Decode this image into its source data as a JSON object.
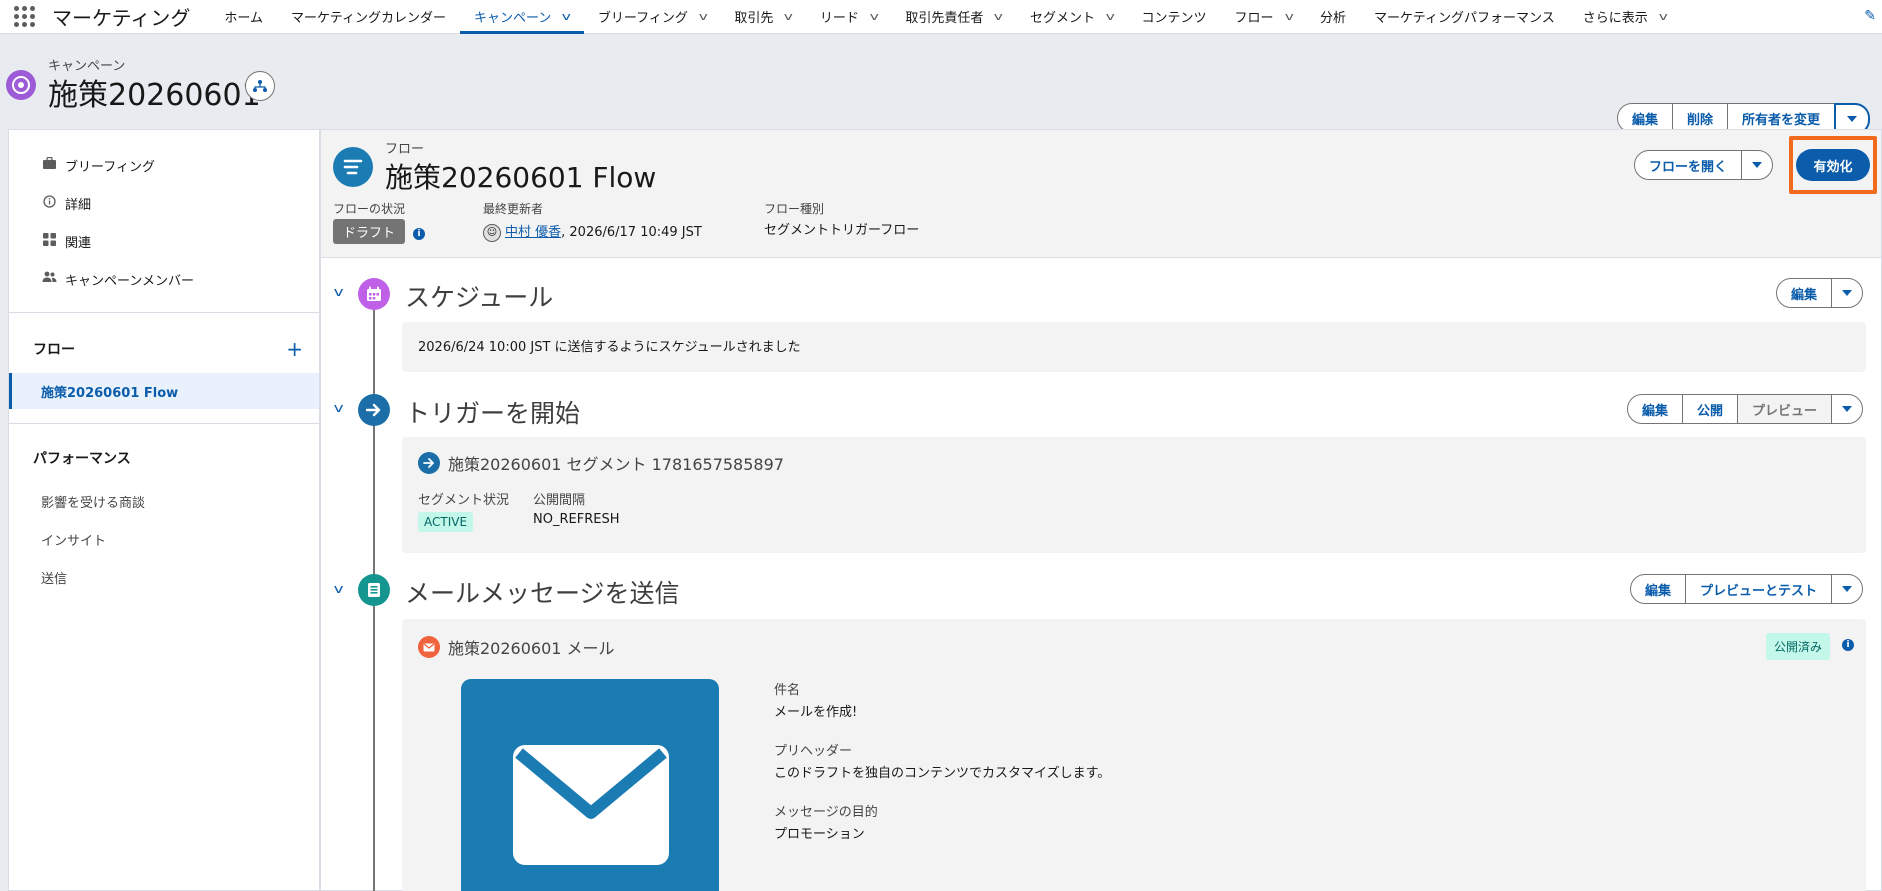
{
  "topnav": {
    "app_name": "マーケティング",
    "items": [
      {
        "label": "ホーム",
        "has_menu": false
      },
      {
        "label": "マーケティングカレンダー",
        "has_menu": false
      },
      {
        "label": "キャンペーン",
        "has_menu": true,
        "active": true
      },
      {
        "label": "ブリーフィング",
        "has_menu": true
      },
      {
        "label": "取引先",
        "has_menu": true
      },
      {
        "label": "リード",
        "has_menu": true
      },
      {
        "label": "取引先責任者",
        "has_menu": true
      },
      {
        "label": "セグメント",
        "has_menu": true
      },
      {
        "label": "コンテンツ",
        "has_menu": false
      },
      {
        "label": "フロー",
        "has_menu": true
      },
      {
        "label": "分析",
        "has_menu": false
      },
      {
        "label": "マーケティングパフォーマンス",
        "has_menu": false
      },
      {
        "label": "さらに表示",
        "has_menu": true
      }
    ]
  },
  "header": {
    "object_label": "キャンペーン",
    "title": "施策20260601",
    "actions": {
      "edit": "編集",
      "delete": "削除",
      "change_owner": "所有者を変更"
    }
  },
  "sidebar": {
    "items": [
      {
        "label": "ブリーフィング",
        "icon": "briefcase-icon"
      },
      {
        "label": "詳細",
        "icon": "info-icon"
      },
      {
        "label": "関連",
        "icon": "grid-icon"
      },
      {
        "label": "キャンペーンメンバー",
        "icon": "people-icon"
      }
    ],
    "flow_section": {
      "title": "フロー",
      "selected_item": "施策20260601 Flow"
    },
    "performance_section": {
      "title": "パフォーマンス",
      "items": [
        "影響を受ける商談",
        "インサイト",
        "送信"
      ]
    }
  },
  "flow": {
    "object_label": "フロー",
    "title": "施策20260601 Flow",
    "status_label": "フローの状況",
    "status_value": "ドラフト",
    "last_modified_label": "最終更新者",
    "last_modified_user": "中村 優香",
    "last_modified_time": ", 2026/6/17 10:49 JST",
    "flow_type_label": "フロー種別",
    "flow_type_value": "セグメントトリガーフロー",
    "open_flow": "フローを開く",
    "activate": "有効化"
  },
  "steps": {
    "schedule": {
      "title": "スケジュール",
      "text": "2026/6/24 10:00 JST に送信するようにスケジュールされました",
      "edit": "編集"
    },
    "trigger": {
      "title": "トリガーを開始",
      "segment_name": "施策20260601 セグメント 1781657585897",
      "segment_status_label": "セグメント状況",
      "segment_status_value": "ACTIVE",
      "publish_interval_label": "公開間隔",
      "publish_interval_value": "NO_REFRESH",
      "edit": "編集",
      "publish": "公開",
      "preview": "プレビュー"
    },
    "email": {
      "title": "メールメッセージを送信",
      "email_name": "施策20260601 メール",
      "status": "公開済み",
      "subject_label": "件名",
      "subject_value": "メールを作成!",
      "preheader_label": "プリヘッダー",
      "preheader_value": "このドラフトを独自のコンテンツでカスタマイズします。",
      "purpose_label": "メッセージの目的",
      "purpose_value": "プロモーション",
      "edit": "編集",
      "preview_test": "プレビューとテスト"
    }
  },
  "colors": {
    "brand_blue": "#0b5cab",
    "highlight": "#f26b1d",
    "campaign_icon": "#9e5bd8",
    "flow_icon": "#1b7bb3",
    "schedule_icon": "#c060e8",
    "trigger_icon": "#1b6ea8",
    "email_step_icon": "#14958f",
    "email_mini_icon": "#f0633c"
  }
}
